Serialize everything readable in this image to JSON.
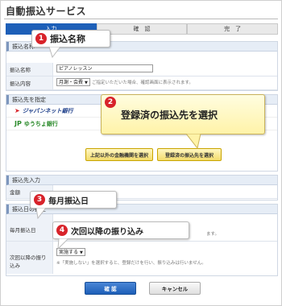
{
  "title": "自動振込サービス",
  "steps": [
    "入力",
    "確　認",
    "完　了"
  ],
  "section1": {
    "header": "振込名称",
    "rows": [
      {
        "label": "振込名称",
        "value": "ピアノレッスン"
      },
      {
        "label": "振込内容",
        "value": "月謝・会費",
        "note": "ご指定いただいた場合、確認画面に表示されます。"
      }
    ]
  },
  "section2": {
    "header": "振込先を指定",
    "banks": [
      "ジャパンネット銀行",
      "ゆうちょ銀行"
    ],
    "btn_other": "上記以外の金融機関を選択",
    "btn_registered": "登録済の振込先を選択"
  },
  "section3": {
    "header": "振込先入力",
    "row_label": "金額"
  },
  "section4": {
    "header": "振込日の指定",
    "rows": [
      {
        "label": "毎月振込日",
        "note": "ます。"
      },
      {
        "label": "次回以降の振り込み",
        "value": "実施する",
        "note": "※「実施しない」を選択すると、登録だけを行い、振り込みは行いません。"
      }
    ]
  },
  "buttons": {
    "confirm": "確 認",
    "cancel": "キャンセル"
  },
  "callouts": [
    {
      "num": "1",
      "text": "振込名称"
    },
    {
      "num": "2",
      "text": "登録済の振込先を選択"
    },
    {
      "num": "3",
      "text": "毎月振込日"
    },
    {
      "num": "4",
      "text": "次回以降の振り込み"
    }
  ],
  "colors": {
    "accent": "#1d5fb8",
    "badge": "#d8232a",
    "callout_yellow": "#fff3a8"
  }
}
